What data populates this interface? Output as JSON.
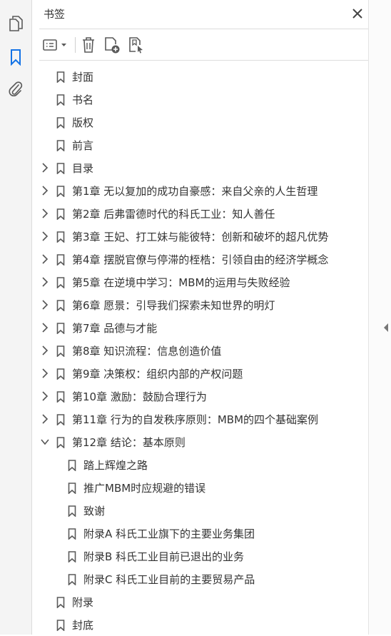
{
  "panel": {
    "title": "书签"
  },
  "rail": {
    "icons": [
      "pages-icon",
      "bookmark-icon",
      "attachment-icon"
    ]
  },
  "toolbar": {
    "icons": [
      "options-menu-icon",
      "delete-icon",
      "new-bookmark-icon",
      "bookmark-from-structure-icon"
    ]
  },
  "bookmarks": [
    {
      "label": "封面",
      "level": 0,
      "expander": "none"
    },
    {
      "label": "书名",
      "level": 0,
      "expander": "none"
    },
    {
      "label": "版权",
      "level": 0,
      "expander": "none"
    },
    {
      "label": "前言",
      "level": 0,
      "expander": "none"
    },
    {
      "label": "目录",
      "level": 0,
      "expander": "collapsed"
    },
    {
      "label": "第1章 无以复加的成功自豪感：来自父亲的人生哲理",
      "level": 0,
      "expander": "collapsed"
    },
    {
      "label": "第2章 后弗雷德时代的科氏工业：知人善任",
      "level": 0,
      "expander": "collapsed"
    },
    {
      "label": "第3章 王妃、打工妹与能彼特：创新和破坏的超凡优势",
      "level": 0,
      "expander": "collapsed"
    },
    {
      "label": "第4章 摆脱官僚与停滞的桎梏：引领自由的经济学概念",
      "level": 0,
      "expander": "collapsed"
    },
    {
      "label": "第5章 在逆境中学习：MBM的运用与失败经验",
      "level": 0,
      "expander": "collapsed"
    },
    {
      "label": "第6章 愿景：引导我们探索未知世界的明灯",
      "level": 0,
      "expander": "collapsed"
    },
    {
      "label": "第7章 品德与才能",
      "level": 0,
      "expander": "collapsed"
    },
    {
      "label": "第8章 知识流程：信息创造价值",
      "level": 0,
      "expander": "collapsed"
    },
    {
      "label": "第9章 决策权：组织内部的产权问题",
      "level": 0,
      "expander": "collapsed"
    },
    {
      "label": "第10章 激励：鼓励合理行为",
      "level": 0,
      "expander": "collapsed"
    },
    {
      "label": "第11章 行为的自发秩序原则：MBM的四个基础案例",
      "level": 0,
      "expander": "collapsed"
    },
    {
      "label": "第12章 结论：基本原则",
      "level": 0,
      "expander": "expanded"
    },
    {
      "label": "踏上辉煌之路",
      "level": 1,
      "expander": "none"
    },
    {
      "label": "推广MBM时应规避的错误",
      "level": 1,
      "expander": "none"
    },
    {
      "label": "致谢",
      "level": 1,
      "expander": "none"
    },
    {
      "label": "附录A 科氏工业旗下的主要业务集团",
      "level": 1,
      "expander": "none"
    },
    {
      "label": "附录B 科氏工业目前已退出的业务",
      "level": 1,
      "expander": "none"
    },
    {
      "label": "附录C 科氏工业目前的主要贸易产品",
      "level": 1,
      "expander": "none"
    },
    {
      "label": "附录",
      "level": 0,
      "expander": "none"
    },
    {
      "label": "封底",
      "level": 0,
      "expander": "none"
    }
  ],
  "colors": {
    "accent": "#1473e6",
    "icon": "#5a5a5a",
    "text": "#333333"
  }
}
